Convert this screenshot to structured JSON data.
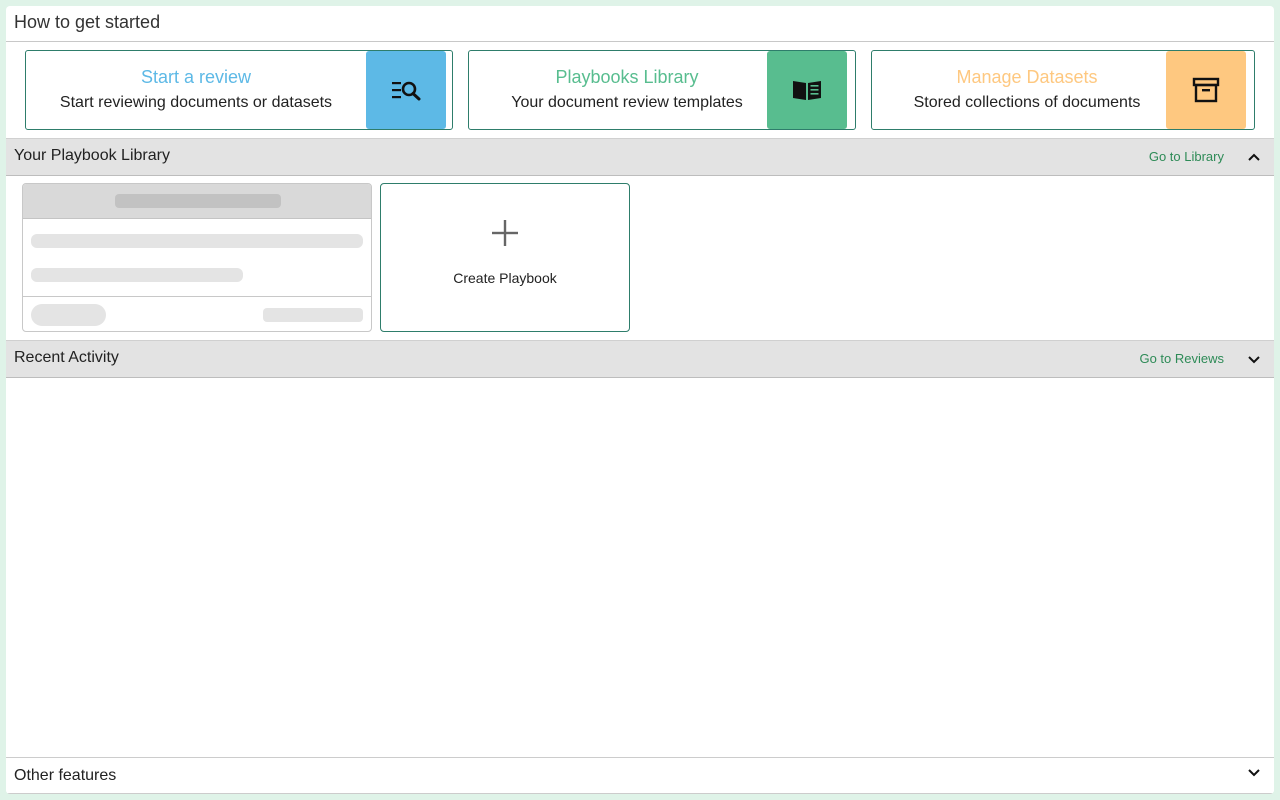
{
  "header": {
    "title": "How to get started"
  },
  "cards": [
    {
      "title": "Start a review",
      "subtitle": "Start reviewing documents or datasets",
      "icon": "search-list-icon",
      "color": "#5db9e6",
      "title_color": "#5db9e6"
    },
    {
      "title": "Playbooks Library",
      "subtitle": "Your document review templates",
      "icon": "book-icon",
      "color": "#58bd8f",
      "title_color": "#58bd8f"
    },
    {
      "title": "Manage Datasets",
      "subtitle": "Stored collections of documents",
      "icon": "archive-icon",
      "color": "#fec880",
      "title_color": "#fec880"
    }
  ],
  "playbook_section": {
    "label": "Your Playbook Library",
    "link": "Go to Library",
    "expanded": true
  },
  "create_playbook": {
    "label": "Create Playbook",
    "icon": "plus-icon"
  },
  "activity_section": {
    "label": "Recent Activity",
    "link": "Go to Reviews",
    "expanded": false
  },
  "other_section": {
    "label": "Other features",
    "expanded": false
  }
}
